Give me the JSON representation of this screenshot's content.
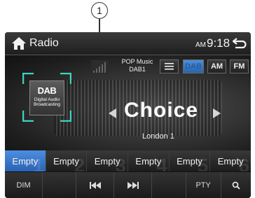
{
  "callout": {
    "number": "1"
  },
  "header": {
    "title": "Radio",
    "ampm": "AM",
    "time": "9:18"
  },
  "station": {
    "genre": "POP Music",
    "service": "DAB1",
    "name": "Choice",
    "ensemble": "London 1"
  },
  "dab_logo": {
    "brand": "DAB",
    "sub": "Digital Audio Broadcasting"
  },
  "band_buttons": {
    "list": "list-icon",
    "dab": "DAB",
    "am": "AM",
    "fm": "FM"
  },
  "presets": [
    {
      "number": "1",
      "label": "Empty"
    },
    {
      "number": "2",
      "label": "Empty"
    },
    {
      "number": "3",
      "label": "Empty"
    },
    {
      "number": "4",
      "label": "Empty"
    },
    {
      "number": "5",
      "label": "Empty"
    },
    {
      "number": "6",
      "label": "Empty"
    }
  ],
  "bottom_bar": {
    "dim": "DIM",
    "pty": "PTY"
  },
  "colors": {
    "accent": "#2f6fc4",
    "background": "#161616",
    "text": "#f2f2f2"
  }
}
